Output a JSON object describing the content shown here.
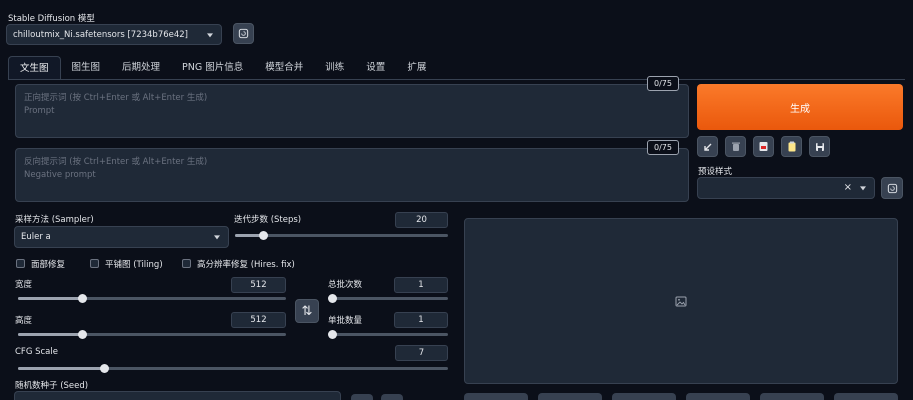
{
  "model": {
    "label": "Stable Diffusion 模型",
    "selected": "chilloutmix_Ni.safetensors [7234b76e42]"
  },
  "tabs": [
    "文生图",
    "图生图",
    "后期处理",
    "PNG 图片信息",
    "模型合并",
    "训练",
    "设置",
    "扩展"
  ],
  "prompt": {
    "counter": "0/75",
    "placeholder_line1": "正向提示词 (按 Ctrl+Enter 或 Alt+Enter 生成)",
    "placeholder_line2": "Prompt"
  },
  "negative": {
    "counter": "0/75",
    "placeholder_line1": "反向提示词 (按 Ctrl+Enter 或 Alt+Enter 生成)",
    "placeholder_line2": "Negative prompt"
  },
  "generate_label": "生成",
  "styles": {
    "label": "预设样式",
    "clear_glyph": "×"
  },
  "sampler": {
    "label": "采样方法 (Sampler)",
    "selected": "Euler a"
  },
  "steps": {
    "label": "迭代步数 (Steps)",
    "value": "20",
    "fraction": 0.13
  },
  "checks": {
    "face": "面部修复",
    "tiling": "平铺图 (Tiling)",
    "hires": "高分辨率修复 (Hires. fix)"
  },
  "width": {
    "label": "宽度",
    "value": "512",
    "fraction": 0.24
  },
  "height": {
    "label": "高度",
    "value": "512",
    "fraction": 0.24
  },
  "batch_count": {
    "label": "总批次数",
    "value": "1",
    "fraction": 0.0
  },
  "batch_size": {
    "label": "单批数量",
    "value": "1",
    "fraction": 0.0
  },
  "cfg": {
    "label": "CFG Scale",
    "value": "7",
    "fraction": 0.2
  },
  "seed": {
    "label": "随机数种子 (Seed)"
  },
  "swap_glyph": "⇅"
}
